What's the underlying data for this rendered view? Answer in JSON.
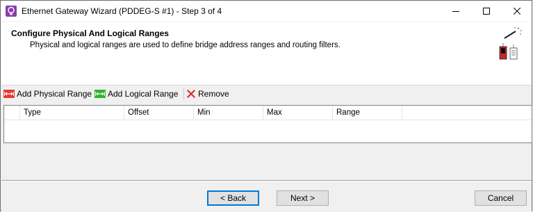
{
  "window": {
    "title": "Ethernet Gateway Wizard (PDDEG-S #1) - Step 3 of 4",
    "controls": {
      "minimize_icon": "minimize-icon",
      "maximize_icon": "maximize-icon",
      "close_icon": "close-icon"
    }
  },
  "header": {
    "title": "Configure Physical And Logical Ranges",
    "subtitle": "Physical and logical ranges are used to define bridge address ranges and routing filters."
  },
  "toolbar": {
    "add_physical_label": "Add Physical Range",
    "add_logical_label": "Add Logical Range",
    "remove_label": "Remove"
  },
  "grid": {
    "columns": [
      "Type",
      "Offset",
      "Min",
      "Max",
      "Range"
    ],
    "rows": []
  },
  "footer": {
    "back_label": "< Back",
    "next_label": "Next >",
    "cancel_label": "Cancel"
  },
  "colors": {
    "physical_icon": "#e53935",
    "logical_icon": "#2fb52f",
    "remove_icon": "#d32f2f",
    "accent": "#0078d7"
  }
}
